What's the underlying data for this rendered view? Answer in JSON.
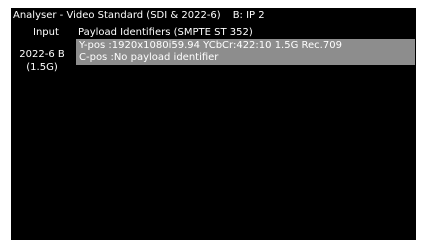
{
  "window": {
    "title": "Analyser - Video Standard (SDI & 2022-6)",
    "bank": "B: IP 2"
  },
  "table": {
    "headers": {
      "input": "Input",
      "payload": "Payload Identifiers (SMPTE ST 352)"
    },
    "rows": [
      {
        "input_line1": "2022-6 B",
        "input_line2": "(1.5G)",
        "y_pos": "Y-pos :1920x1080i59.94 YCbCr:422:10 1.5G Rec.709",
        "c_pos": "C-pos :No payload identifier"
      }
    ]
  },
  "colors": {
    "background": "#000000",
    "text": "#ffffff",
    "selected_row": "#8d8d8d"
  }
}
